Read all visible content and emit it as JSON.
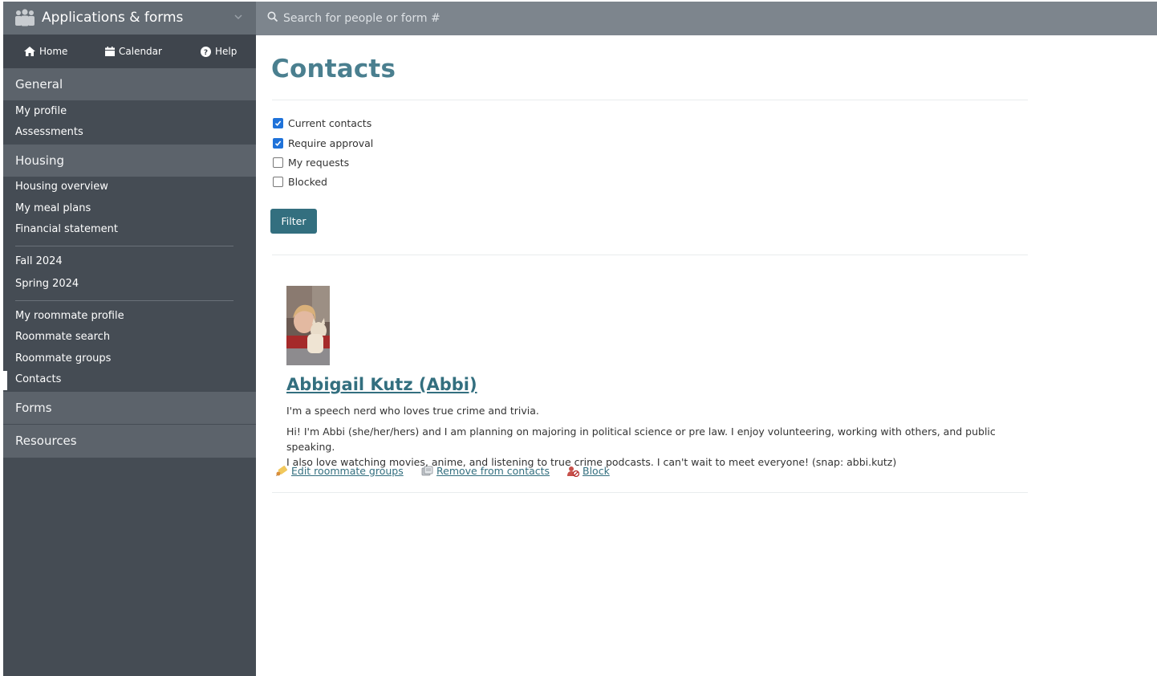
{
  "app": {
    "title": "Applications & forms"
  },
  "nav": {
    "home": "Home",
    "calendar": "Calendar",
    "help": "Help"
  },
  "search": {
    "placeholder": "Search for people or form #"
  },
  "sidebar": {
    "general": {
      "heading": "General",
      "items": [
        "My profile",
        "Assessments"
      ]
    },
    "housing": {
      "heading": "Housing",
      "items": [
        "Housing overview",
        "My meal plans",
        "Financial statement"
      ],
      "terms": [
        "Fall 2024",
        "Spring 2024"
      ],
      "roommate": [
        "My roommate profile",
        "Roommate search",
        "Roommate groups",
        "Contacts"
      ]
    },
    "forms": {
      "heading": "Forms"
    },
    "resources": {
      "heading": "Resources"
    },
    "active_item": "Contacts"
  },
  "main": {
    "title": "Contacts",
    "filters": [
      {
        "label": "Current contacts",
        "checked": true
      },
      {
        "label": "Require approval",
        "checked": true
      },
      {
        "label": "My requests",
        "checked": false
      },
      {
        "label": "Blocked",
        "checked": false
      }
    ],
    "filter_button": "Filter",
    "contact": {
      "name": "Abbigail Kutz (Abbi)",
      "tagline": "I'm a speech nerd who loves true crime and trivia.",
      "bio_line1": "Hi! I'm Abbi (she/her/hers) and I am planning on majoring in political science or pre law. I enjoy volunteering, working with others, and public speaking.",
      "bio_line2": "I also love watching movies, anime, and listening to true crime podcasts. I can't wait to meet everyone! (snap: abbi.kutz)",
      "actions": {
        "edit_groups": "Edit roommate groups",
        "remove": "Remove from contacts",
        "block": "Block"
      }
    }
  },
  "colors": {
    "accent": "#336f7f",
    "title": "#4a7f8f",
    "sidebar": "#454c54",
    "topbar": "#7d858d"
  }
}
